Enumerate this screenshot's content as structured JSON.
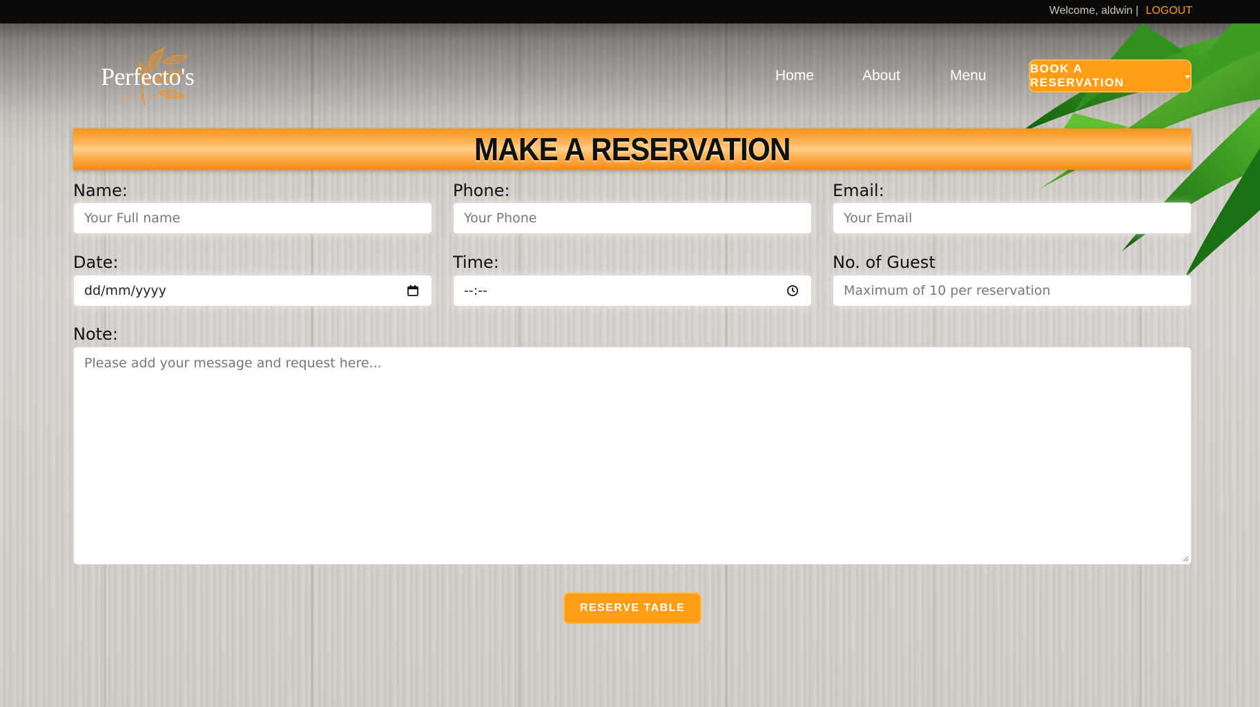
{
  "topbar": {
    "welcome_text": "Welcome, aldwin |",
    "logout_label": "LOGOUT"
  },
  "brand": {
    "name": "Perfecto's",
    "subtitle": "RESTAURANT",
    "accent_color": "#ff9d14"
  },
  "nav": {
    "items": [
      {
        "label": "Home"
      },
      {
        "label": "About"
      },
      {
        "label": "Menu"
      }
    ],
    "book_label": "BOOK A RESERVATION"
  },
  "page": {
    "title": "MAKE A RESERVATION"
  },
  "form": {
    "name": {
      "label": "Name:",
      "placeholder": "Your Full name"
    },
    "phone": {
      "label": "Phone:",
      "placeholder": "Your Phone"
    },
    "email": {
      "label": "Email:",
      "placeholder": "Your Email"
    },
    "date": {
      "label": "Date:",
      "value": "dd/mm/yyyy",
      "icon": "calendar-icon"
    },
    "time": {
      "label": "Time:",
      "value": "--:--",
      "icon": "clock-icon"
    },
    "guests": {
      "label": "No. of Guest",
      "placeholder": "Maximum of 10 per reservation"
    },
    "note": {
      "label": "Note:",
      "placeholder": "Please add your message and request here..."
    },
    "submit_label": "RESERVE TABLE"
  }
}
